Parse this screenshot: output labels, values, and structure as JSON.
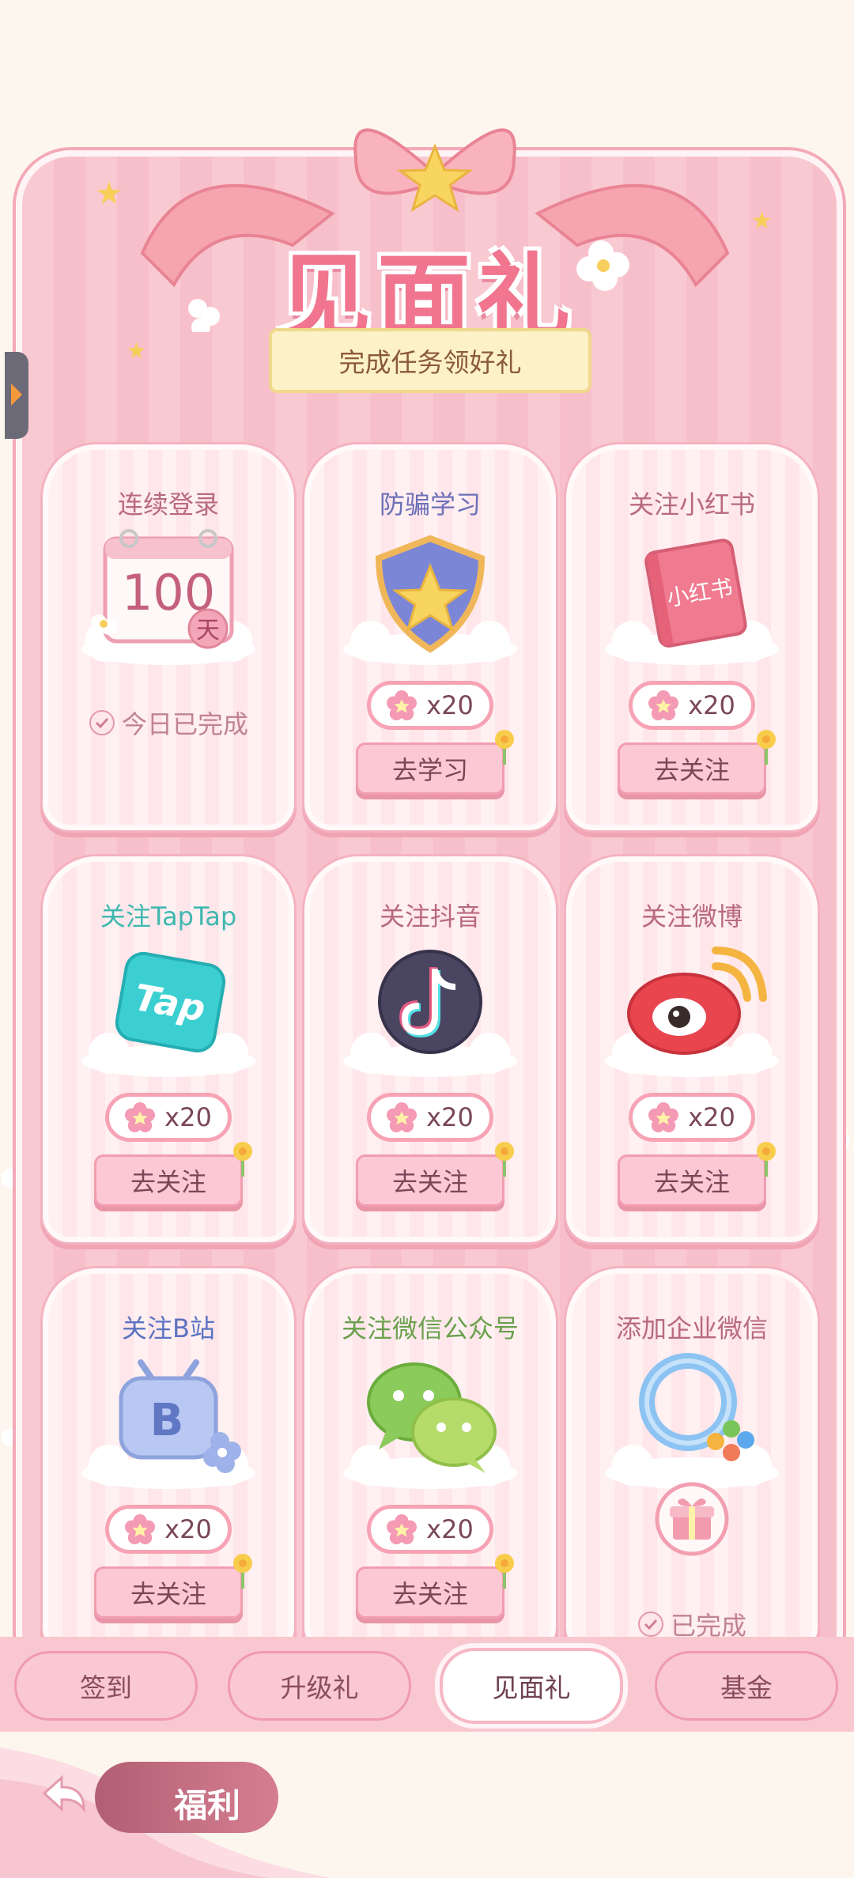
{
  "header": {
    "title": "见面礼",
    "subtitle": "完成任务领好礼"
  },
  "tasks": [
    {
      "title": "连续登录",
      "icon": "calendar-icon",
      "calendar_number": "100",
      "calendar_unit": "天",
      "status": "今日已完成"
    },
    {
      "title": "防骗学习",
      "icon": "shield-star-icon",
      "reward": "x20",
      "button": "去学习"
    },
    {
      "title": "关注小红书",
      "icon": "xiaohongshu-book-icon",
      "icon_text": "小红书",
      "reward": "x20",
      "button": "去关注"
    },
    {
      "title": "关注TapTap",
      "icon": "taptap-icon",
      "icon_text": "Tap",
      "reward": "x20",
      "button": "去关注"
    },
    {
      "title": "关注抖音",
      "icon": "douyin-icon",
      "reward": "x20",
      "button": "去关注"
    },
    {
      "title": "关注微博",
      "icon": "weibo-icon",
      "reward": "x20",
      "button": "去关注"
    },
    {
      "title": "关注B站",
      "icon": "bilibili-icon",
      "icon_text": "B",
      "reward": "x20",
      "button": "去关注"
    },
    {
      "title": "关注微信公众号",
      "icon": "wechat-icon",
      "reward": "x20",
      "button": "去关注"
    },
    {
      "title": "添加企业微信",
      "icon": "wecom-icon",
      "status": "已完成"
    }
  ],
  "tabs": [
    {
      "label": "签到",
      "active": false
    },
    {
      "label": "升级礼",
      "active": false
    },
    {
      "label": "见面礼",
      "active": true
    },
    {
      "label": "基金",
      "active": false
    }
  ],
  "footer": {
    "welfare_label": "福利"
  },
  "colors": {
    "title_pink": "#f1758f",
    "panel_pink": "#f9c9d2",
    "card_bg": "#fff0f2",
    "text_brown": "#7a4758",
    "title_colors": [
      "#b86a7f",
      "#6b70b8",
      "#b86a7f",
      "#3fb8b0",
      "#b86a7f",
      "#b86a7f",
      "#5b73c2",
      "#6aa04c",
      "#b86a7f"
    ]
  }
}
